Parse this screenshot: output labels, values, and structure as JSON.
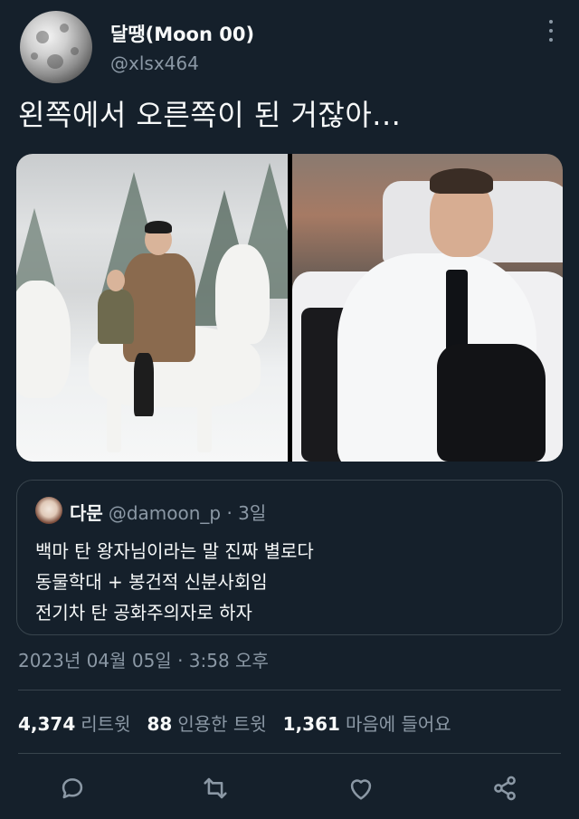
{
  "author": {
    "name": "달땡(Moon 00)",
    "handle": "@xlsx464"
  },
  "tweet": {
    "text": "왼쪽에서 오른쪽이 된 거잖아..."
  },
  "quoted": {
    "name": "다문",
    "meta": "@damoon_p · 3일",
    "lines": [
      "백마 탄 왕자님이라는 말 진짜 별로다",
      "동물학대 + 봉건적 신분사회임",
      "전기차 탄 공화주의자로 하자"
    ]
  },
  "timestamp": "2023년 04월 05일 · 3:58 오후",
  "stats": {
    "retweets_count": "4,374",
    "retweets_label": "리트윗",
    "quotes_count": "88",
    "quotes_label": "인용한 트윗",
    "likes_count": "1,361",
    "likes_label": "마음에 들어요"
  },
  "icons": {
    "more": "more-vertical-icon",
    "reply": "reply-icon",
    "retweet": "retweet-icon",
    "like": "heart-icon",
    "share": "share-icon"
  },
  "colors": {
    "background": "#15202b",
    "text": "#f7f9f9",
    "secondary": "#8b98a5",
    "border": "#38444d"
  }
}
